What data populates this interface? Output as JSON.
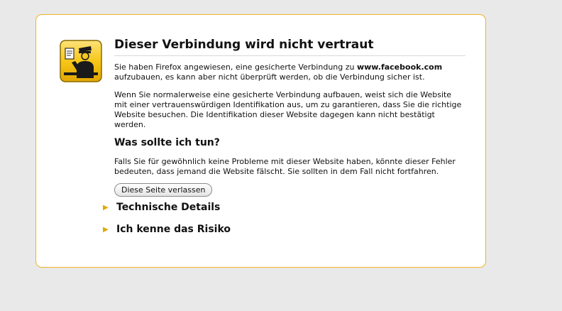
{
  "error_page": {
    "title": "Dieser Verbindung wird nicht vertraut",
    "intro_prefix": "Sie haben Firefox angewiesen, eine gesicherte Verbindung zu ",
    "domain": "www.facebook.com",
    "intro_suffix": " aufzubauen, es kann aber nicht überprüft werden, ob die Verbindung sicher ist.",
    "explanation": "Wenn Sie normalerweise eine gesicherte Verbindung aufbauen, weist sich die Website mit einer vertrauenswürdigen Identifikation aus, um zu garantieren, dass Sie die richtige Website besuchen. Die Identifikation dieser Website dagegen kann nicht bestätigt werden.",
    "what_to_do_heading": "Was sollte ich tun?",
    "what_to_do_text": "Falls Sie für gewöhnlich keine Probleme mit dieser Website haben, könnte dieser Fehler bedeuten, dass jemand die Website fälscht. Sie sollten in dem Fall nicht fortfahren.",
    "leave_button_label": "Diese Seite verlassen",
    "technical_details_label": "Technische Details",
    "risk_label": "Ich kenne das Risiko"
  },
  "icons": {
    "cert_icon": "certificate-guard-icon",
    "expander_icon": "triangle-right-icon"
  },
  "colors": {
    "background": "#e9e9e9",
    "box_border": "#f0b429",
    "icon_yellow": "#f7c719",
    "arrow": "#e0a800"
  }
}
